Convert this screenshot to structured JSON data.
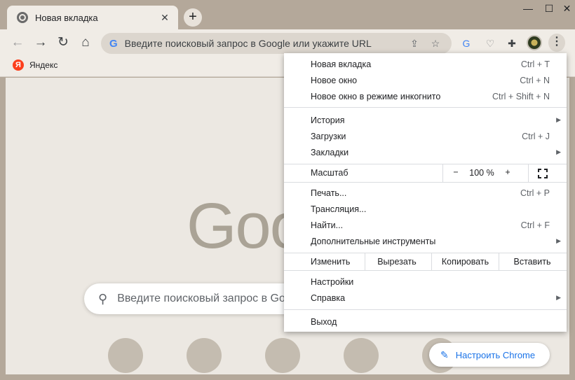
{
  "tab": {
    "title": "Новая вкладка",
    "close": "✕"
  },
  "window": {
    "newtab": "+",
    "minimize": "—",
    "maximize": "☐",
    "close": "✕"
  },
  "toolbar": {
    "back": "←",
    "forward": "→",
    "reload": "↻",
    "home": "⌂",
    "omnibox_g": "G",
    "omnibox_text": "Введите поисковый запрос в Google или укажите URL",
    "menu": "⋮"
  },
  "bookmarks": {
    "yandex_icon": "Я",
    "yandex": "Яндекс"
  },
  "ntp": {
    "logo": "Goog",
    "search_placeholder": "Введите поисковый запрос в Google или укажите URL",
    "customize": "Настроить Chrome"
  },
  "menu": {
    "new_tab": {
      "label": "Новая вкладка",
      "shortcut": "Ctrl + T"
    },
    "new_window": {
      "label": "Новое окно",
      "shortcut": "Ctrl + N"
    },
    "incognito": {
      "label": "Новое окно в режиме инкогнито",
      "shortcut": "Ctrl + Shift + N"
    },
    "history": {
      "label": "История"
    },
    "downloads": {
      "label": "Загрузки",
      "shortcut": "Ctrl + J"
    },
    "bookmarks": {
      "label": "Закладки"
    },
    "zoom": {
      "label": "Масштаб",
      "minus": "−",
      "value": "100 %",
      "plus": "+"
    },
    "print": {
      "label": "Печать...",
      "shortcut": "Ctrl + P"
    },
    "cast": {
      "label": "Трансляция..."
    },
    "find": {
      "label": "Найти...",
      "shortcut": "Ctrl + F"
    },
    "more_tools": {
      "label": "Дополнительные инструменты"
    },
    "edit": {
      "label": "Изменить",
      "cut": "Вырезать",
      "copy": "Копировать",
      "paste": "Вставить"
    },
    "settings": {
      "label": "Настройки"
    },
    "help": {
      "label": "Справка"
    },
    "exit": {
      "label": "Выход"
    }
  }
}
